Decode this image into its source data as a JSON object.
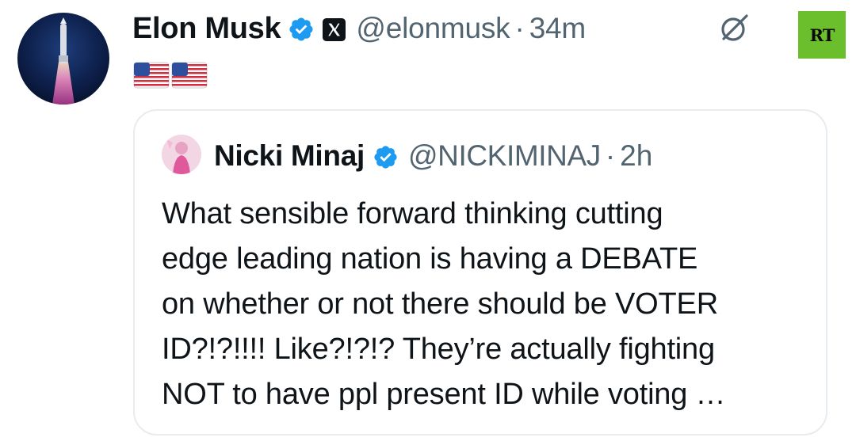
{
  "tweet": {
    "author_name": "Elon Musk",
    "author_handle": "@elonmusk",
    "separator": "·",
    "time": "34m",
    "verified_icon": "verified-badge-icon",
    "affiliation_icon": "x-logo-icon",
    "body_emoji": [
      "🇺🇸",
      "🇺🇸"
    ]
  },
  "header_right": {
    "grok_icon": "grok-icon",
    "watermark_text": "RT"
  },
  "quoted_tweet": {
    "author_name": "Nicki Minaj",
    "author_handle": "@NICKIMINAJ",
    "separator": "·",
    "time": "2h",
    "verified_icon": "verified-badge-icon",
    "text_lines": [
      "What sensible forward thinking cutting",
      "edge leading nation is having a DEBATE",
      "on whether or not there should be VOTER",
      "ID?!?!!!! Like?!?!? They’re actually fighting",
      "NOT to have ppl present ID while voting …"
    ]
  },
  "colors": {
    "verified_blue": "#1d9bf0",
    "secondary_text": "#536471",
    "card_border": "#e7ecf0",
    "rt_green": "#6cbf2c"
  }
}
